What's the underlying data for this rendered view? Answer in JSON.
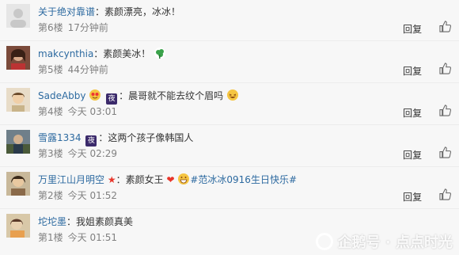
{
  "comments": [
    {
      "user": "关于绝对靠谱",
      "text": "：素颜漂亮，冰冰！",
      "floor": "第6楼",
      "time": "17分钟前",
      "reply": "回复",
      "likes": "赞"
    },
    {
      "user": "makcynthia",
      "text": "：素颜美冰！",
      "floor": "第5楼",
      "time": "44分钟前",
      "reply": "回复",
      "likes": "赞"
    },
    {
      "user": "SadeAbby",
      "badge": "夜",
      "text": "：晨哥就不能去纹个眉吗",
      "floor": "第4楼",
      "time": "今天 03:01",
      "reply": "回复",
      "likes": "赞"
    },
    {
      "user": "雪露1334",
      "badge": "夜",
      "text": "：这两个孩子像韩国人",
      "floor": "第3楼",
      "time": "今天 02:29",
      "reply": "回复",
      "likes": "赞"
    },
    {
      "user": "万里江山月明空",
      "text": "：素颜女王",
      "hashtag": "#范冰冰0916生日快乐#",
      "floor": "第2楼",
      "time": "今天 01:52",
      "reply": "回复",
      "likes": "赞"
    },
    {
      "user": "坨坨墨",
      "text": "：我姐素颜真美",
      "floor": "第1楼",
      "time": "今天 01:51",
      "reply": "回复",
      "likes": "赞"
    }
  ],
  "watermark": "企鹅号 · 点点时光",
  "colors": {
    "link": "#2d6aa0",
    "meta": "#808080",
    "background": "#f7f7f7"
  }
}
